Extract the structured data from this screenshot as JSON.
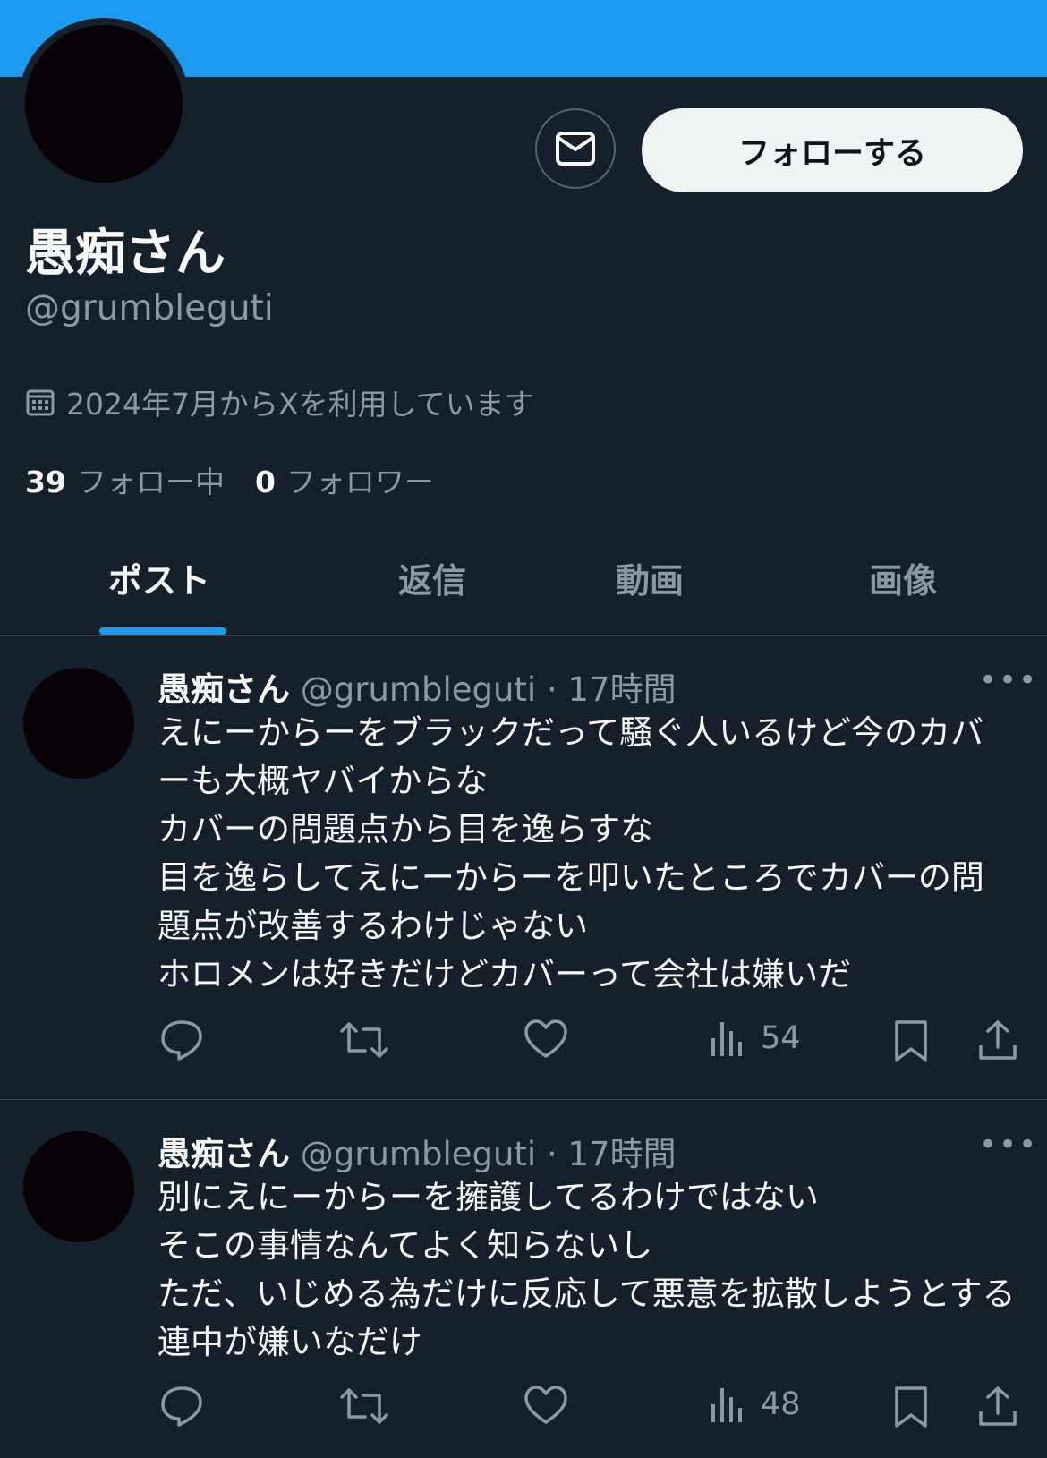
{
  "profile": {
    "display_name": "愚痴さん",
    "handle": "@grumbleguti",
    "joined": "2024年7月からXを利用しています",
    "follow_label": "フォローする",
    "following_count": "39",
    "following_label": "フォロー中",
    "followers_count": "0",
    "followers_label": "フォロワー"
  },
  "tabs": [
    {
      "label": "ポスト"
    },
    {
      "label": "返信"
    },
    {
      "label": "動画"
    },
    {
      "label": "画像"
    }
  ],
  "tweets": [
    {
      "name": "愚痴さん",
      "handle": "@grumbleguti",
      "time": "17時間",
      "text": "えにーからーをブラックだって騒ぐ人いるけど今のカバーも大概ヤバイからな\nカバーの問題点から目を逸らすな\n目を逸らしてえにーからーを叩いたところでカバーの問題点が改善するわけじゃない\nホロメンは好きだけどカバーって会社は嫌いだ",
      "views": "54"
    },
    {
      "name": "愚痴さん",
      "handle": "@grumbleguti",
      "time": "17時間",
      "text": "別にえにーからーを擁護してるわけではない\nそこの事情なんてよく知らないし\nただ、いじめる為だけに反応して悪意を拡散しようとする連中が嫌いなだけ",
      "views": "48"
    }
  ],
  "colors": {
    "background": "#15202b",
    "banner": "#1d9bf0",
    "accent": "#1d9bf0",
    "secondary_text": "#8b98a5"
  },
  "icons": [
    "mail-icon",
    "calendar-icon",
    "more-icon",
    "reply-icon",
    "retweet-icon",
    "like-icon",
    "views-icon",
    "bookmark-icon",
    "share-icon"
  ]
}
